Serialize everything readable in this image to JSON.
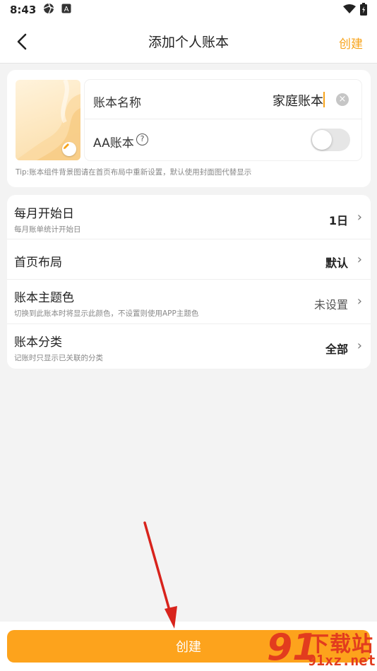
{
  "status_bar": {
    "time": "8:43",
    "icons": [
      "aperture-icon",
      "a-box-icon",
      "wifi-icon",
      "battery-icon"
    ]
  },
  "app_bar": {
    "title": "添加个人账本",
    "action_label": "创建",
    "accent_color": "#f7a31a"
  },
  "book_form": {
    "name_label": "账本名称",
    "name_value": "家庭账本",
    "aa_label": "AA账本",
    "aa_enabled": false,
    "tip": "Tip:账本组件背景图请在首页布局中重新设置，默认使用封面图代替显示"
  },
  "settings": [
    {
      "title": "每月开始日",
      "subtitle": "每月账单统计开始日",
      "value": "1日"
    },
    {
      "title": "首页布局",
      "subtitle": "",
      "value": "默认"
    },
    {
      "title": "账本主题色",
      "subtitle": "切换到此账本时将显示此颜色，不设置则使用APP主题色",
      "value": "未设置"
    },
    {
      "title": "账本分类",
      "subtitle": "记账时只显示已关联的分类",
      "value": "全部"
    }
  ],
  "bottom": {
    "create_label": "创建",
    "button_color": "#fda31c"
  },
  "watermark": {
    "logo": "91",
    "text": "下载站",
    "url": "91xz.net"
  }
}
